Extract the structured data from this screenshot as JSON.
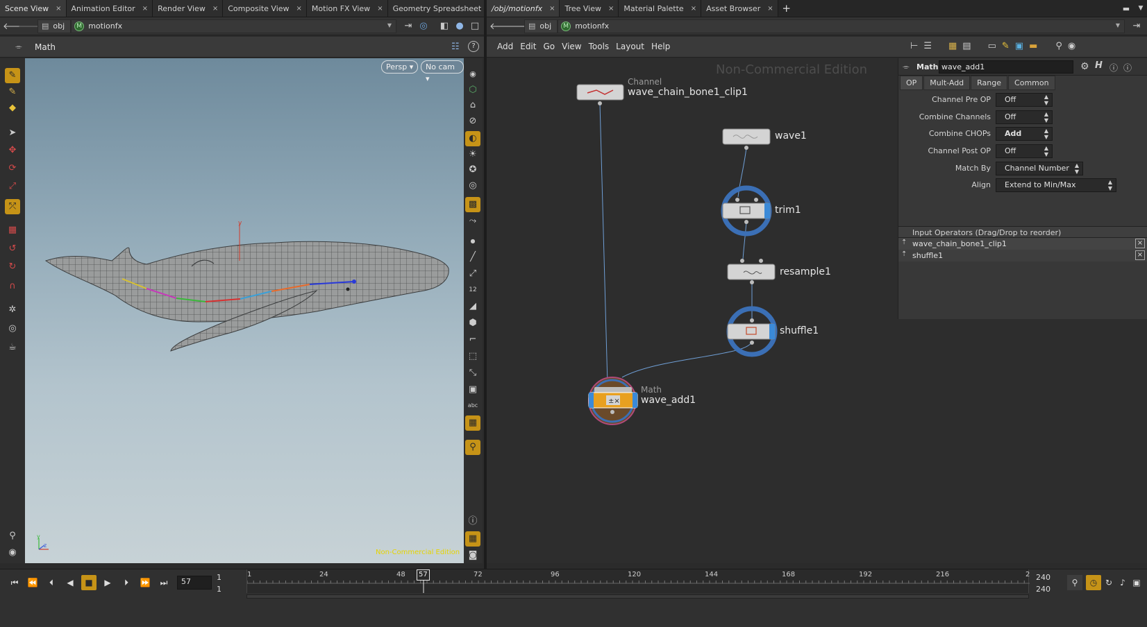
{
  "left_tabs": [
    {
      "label": "Scene View"
    },
    {
      "label": "Animation Editor"
    },
    {
      "label": "Render View"
    },
    {
      "label": "Composite View"
    },
    {
      "label": "Motion FX View"
    },
    {
      "label": "Geometry Spreadsheet"
    }
  ],
  "right_tabs": [
    {
      "label": "/obj/motionfx"
    },
    {
      "label": "Tree View"
    },
    {
      "label": "Material Palette"
    },
    {
      "label": "Asset Browser"
    }
  ],
  "tab_close_glyph": "×",
  "tab_add_glyph": "+",
  "left_path": {
    "root": "obj",
    "context": "motionfx",
    "context_icon": "M"
  },
  "right_path": {
    "root": "obj",
    "context": "motionfx",
    "context_icon": "M"
  },
  "scene": {
    "toolbar_title": "Math",
    "persp_button": "Persp ▾",
    "cam_button": "No cam ▾",
    "watermark": "Non-Commercial Edition",
    "axis_y": "y",
    "gizmo_y": "y",
    "gizmo_z": "z"
  },
  "network": {
    "menus": [
      "Add",
      "Edit",
      "Go",
      "View",
      "Tools",
      "Layout",
      "Help"
    ],
    "watermark": "Non-Commercial Edition",
    "nodes": [
      {
        "name": "wave_chain_bone1_clip1",
        "type": "Channel"
      },
      {
        "name": "wave1"
      },
      {
        "name": "trim1"
      },
      {
        "name": "resample1"
      },
      {
        "name": "shuffle1"
      },
      {
        "name": "wave_add1",
        "type": "Math"
      }
    ]
  },
  "params": {
    "type_label": "Math",
    "node_name": "wave_add1",
    "tabs": [
      "OP",
      "Mult-Add",
      "Range",
      "Common"
    ],
    "rows": [
      {
        "label": "Channel Pre OP",
        "value": "Off"
      },
      {
        "label": "Combine Channels",
        "value": "Off"
      },
      {
        "label": "Combine CHOPs",
        "value": "Add"
      },
      {
        "label": "Channel Post OP",
        "value": "Off"
      },
      {
        "label": "Match By",
        "value": "Channel Number"
      },
      {
        "label": "Align",
        "value": "Extend to Min/Max"
      }
    ],
    "inputs_header": "Input Operators (Drag/Drop to reorder)",
    "inputs": [
      "wave_chain_bone1_clip1",
      "shuffle1"
    ],
    "remove_glyph": "×"
  },
  "timeline": {
    "current_frame": "57",
    "start_a": "1",
    "start_b": "1",
    "end_a": "240",
    "end_b": "240",
    "ticks": [
      "1",
      "24",
      "48",
      "72",
      "96",
      "120",
      "144",
      "168",
      "192",
      "216",
      "2"
    ],
    "current_marker": "57"
  },
  "colors": {
    "accent": "#c69317",
    "node_ring": "#3b6fb5",
    "wire": "#6f9fd6",
    "selected_ring": "#b04a7a"
  }
}
